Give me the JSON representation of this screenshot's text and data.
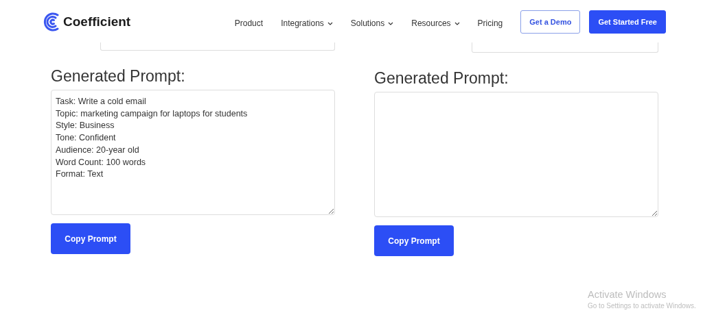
{
  "header": {
    "logo": "Coefficient",
    "nav": [
      {
        "label": "Product",
        "dropdown": false
      },
      {
        "label": "Integrations",
        "dropdown": true
      },
      {
        "label": "Solutions",
        "dropdown": true
      },
      {
        "label": "Resources",
        "dropdown": true
      },
      {
        "label": "Pricing",
        "dropdown": false
      }
    ],
    "buttons": [
      {
        "label": "Get a Demo",
        "kind": "outline"
      },
      {
        "label": "Get Started Free",
        "kind": "primary"
      }
    ]
  },
  "columns": [
    {
      "field": {
        "kind": "select"
      },
      "heading": "Generated Prompt:",
      "prompt_lines": [
        "Task: Write a cold email",
        "Topic: marketing campaign for laptops for students",
        "Style: Business",
        "Tone: Confident",
        "Audience: 20-year old",
        "Word Count: 100 words",
        "Format: Text"
      ],
      "button": "Copy Prompt"
    },
    {
      "field": {
        "kind": "input"
      },
      "heading": "Generated Prompt:",
      "button": "Copy Prompt"
    }
  ],
  "os_notice": {
    "title": "Activate Windows",
    "subtitle": "Go to Settings to activate Windows."
  }
}
